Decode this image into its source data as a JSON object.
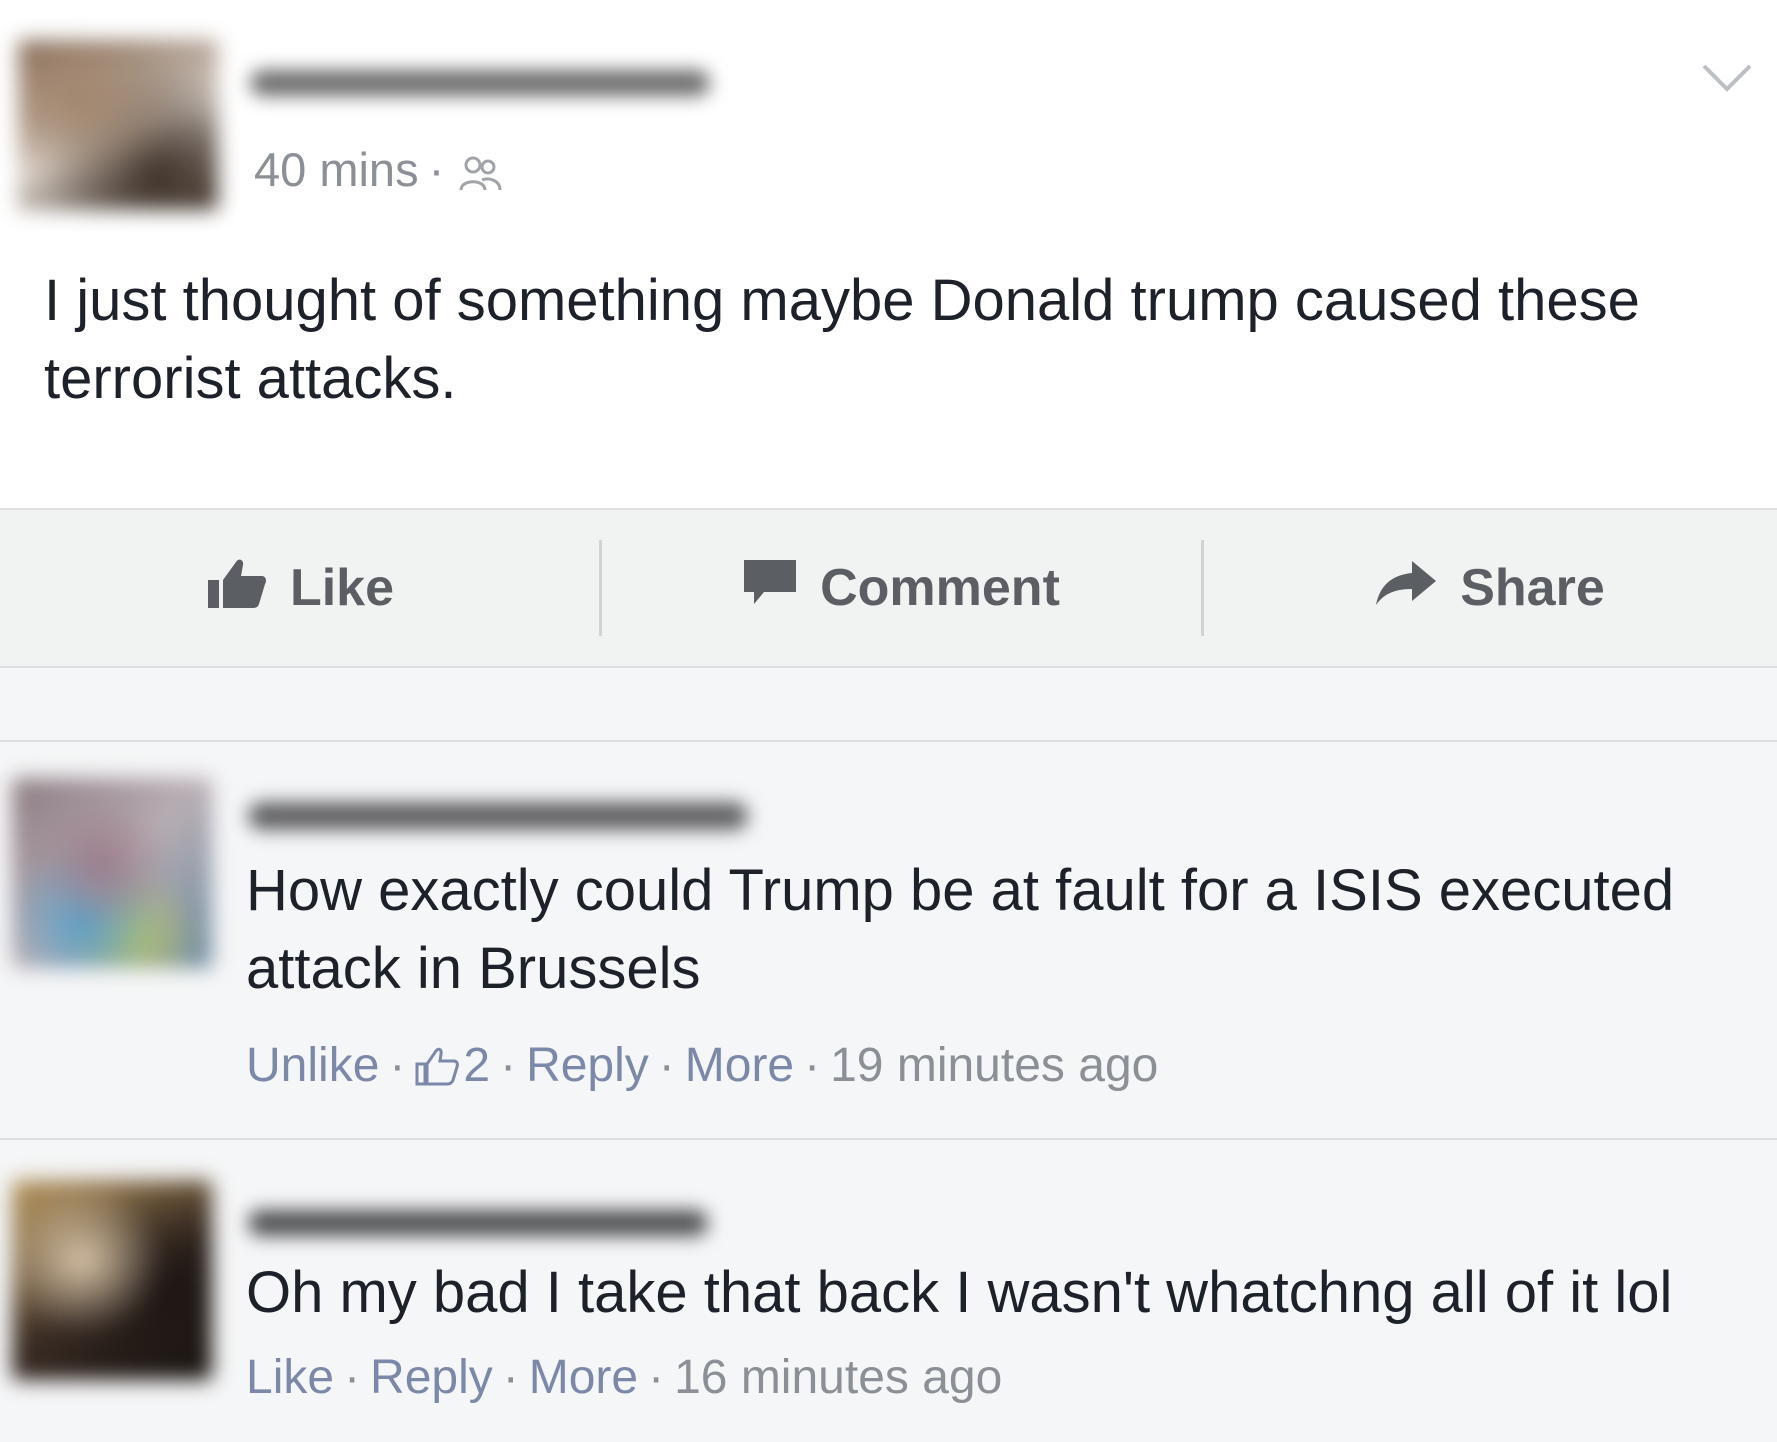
{
  "post": {
    "timestamp": "40 mins",
    "separator": "·",
    "audience_icon": "friends-icon",
    "menu_icon": "chevron-down-icon",
    "text": "I just thought of something maybe Donald trump caused these terrorist attacks."
  },
  "actions": {
    "like_label": "Like",
    "comment_label": "Comment",
    "share_label": "Share"
  },
  "comments": [
    {
      "text": "How exactly could Trump be at fault for a ISIS executed attack in Brussels",
      "like_action": "Unlike",
      "like_count": "2",
      "reply_label": "Reply",
      "more_label": "More",
      "time": "19 minutes ago"
    },
    {
      "text": "Oh my bad I take that back I wasn't whatchng all of it lol",
      "like_action": "Like",
      "reply_label": "Reply",
      "more_label": "More",
      "time": "16 minutes ago"
    }
  ],
  "colors": {
    "link": "#7b88a8",
    "meta": "#8b8f96",
    "text": "#1d2129",
    "action": "#5b5e63"
  }
}
